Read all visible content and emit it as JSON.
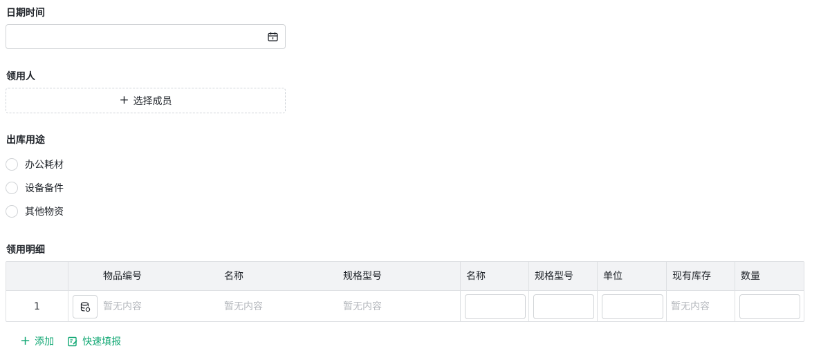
{
  "form": {
    "datetime": {
      "label": "日期时间",
      "value": ""
    },
    "recipient": {
      "label": "领用人",
      "picker_label": "选择成员"
    },
    "purpose": {
      "label": "出库用途",
      "options": [
        "办公耗材",
        "设备备件",
        "其他物资"
      ]
    },
    "details": {
      "label": "领用明细",
      "columns": [
        "物品编号",
        "名称",
        "规格型号",
        "名称",
        "规格型号",
        "单位",
        "现有库存",
        "数量"
      ],
      "rows": [
        {
          "index": "1",
          "item_code": "暂无内容",
          "name": "暂无内容",
          "spec": "暂无内容",
          "stock": "暂无内容"
        }
      ]
    }
  },
  "actions": {
    "add_label": "添加",
    "quick_fill_label": "快速填报"
  },
  "colors": {
    "accent": "#10a773",
    "placeholder": "#b5b8bd",
    "header_bg": "#f2f3f5"
  }
}
